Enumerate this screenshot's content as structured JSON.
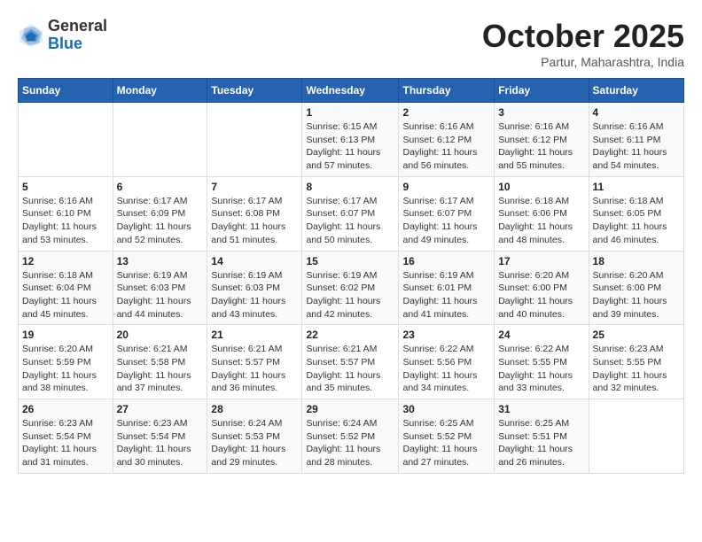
{
  "header": {
    "logo": {
      "general": "General",
      "blue": "Blue"
    },
    "title": "October 2025",
    "location": "Partur, Maharashtra, India"
  },
  "weekdays": [
    "Sunday",
    "Monday",
    "Tuesday",
    "Wednesday",
    "Thursday",
    "Friday",
    "Saturday"
  ],
  "weeks": [
    [
      {
        "day": "",
        "info": ""
      },
      {
        "day": "",
        "info": ""
      },
      {
        "day": "",
        "info": ""
      },
      {
        "day": "1",
        "info": "Sunrise: 6:15 AM\nSunset: 6:13 PM\nDaylight: 11 hours\nand 57 minutes."
      },
      {
        "day": "2",
        "info": "Sunrise: 6:16 AM\nSunset: 6:12 PM\nDaylight: 11 hours\nand 56 minutes."
      },
      {
        "day": "3",
        "info": "Sunrise: 6:16 AM\nSunset: 6:12 PM\nDaylight: 11 hours\nand 55 minutes."
      },
      {
        "day": "4",
        "info": "Sunrise: 6:16 AM\nSunset: 6:11 PM\nDaylight: 11 hours\nand 54 minutes."
      }
    ],
    [
      {
        "day": "5",
        "info": "Sunrise: 6:16 AM\nSunset: 6:10 PM\nDaylight: 11 hours\nand 53 minutes."
      },
      {
        "day": "6",
        "info": "Sunrise: 6:17 AM\nSunset: 6:09 PM\nDaylight: 11 hours\nand 52 minutes."
      },
      {
        "day": "7",
        "info": "Sunrise: 6:17 AM\nSunset: 6:08 PM\nDaylight: 11 hours\nand 51 minutes."
      },
      {
        "day": "8",
        "info": "Sunrise: 6:17 AM\nSunset: 6:07 PM\nDaylight: 11 hours\nand 50 minutes."
      },
      {
        "day": "9",
        "info": "Sunrise: 6:17 AM\nSunset: 6:07 PM\nDaylight: 11 hours\nand 49 minutes."
      },
      {
        "day": "10",
        "info": "Sunrise: 6:18 AM\nSunset: 6:06 PM\nDaylight: 11 hours\nand 48 minutes."
      },
      {
        "day": "11",
        "info": "Sunrise: 6:18 AM\nSunset: 6:05 PM\nDaylight: 11 hours\nand 46 minutes."
      }
    ],
    [
      {
        "day": "12",
        "info": "Sunrise: 6:18 AM\nSunset: 6:04 PM\nDaylight: 11 hours\nand 45 minutes."
      },
      {
        "day": "13",
        "info": "Sunrise: 6:19 AM\nSunset: 6:03 PM\nDaylight: 11 hours\nand 44 minutes."
      },
      {
        "day": "14",
        "info": "Sunrise: 6:19 AM\nSunset: 6:03 PM\nDaylight: 11 hours\nand 43 minutes."
      },
      {
        "day": "15",
        "info": "Sunrise: 6:19 AM\nSunset: 6:02 PM\nDaylight: 11 hours\nand 42 minutes."
      },
      {
        "day": "16",
        "info": "Sunrise: 6:19 AM\nSunset: 6:01 PM\nDaylight: 11 hours\nand 41 minutes."
      },
      {
        "day": "17",
        "info": "Sunrise: 6:20 AM\nSunset: 6:00 PM\nDaylight: 11 hours\nand 40 minutes."
      },
      {
        "day": "18",
        "info": "Sunrise: 6:20 AM\nSunset: 6:00 PM\nDaylight: 11 hours\nand 39 minutes."
      }
    ],
    [
      {
        "day": "19",
        "info": "Sunrise: 6:20 AM\nSunset: 5:59 PM\nDaylight: 11 hours\nand 38 minutes."
      },
      {
        "day": "20",
        "info": "Sunrise: 6:21 AM\nSunset: 5:58 PM\nDaylight: 11 hours\nand 37 minutes."
      },
      {
        "day": "21",
        "info": "Sunrise: 6:21 AM\nSunset: 5:57 PM\nDaylight: 11 hours\nand 36 minutes."
      },
      {
        "day": "22",
        "info": "Sunrise: 6:21 AM\nSunset: 5:57 PM\nDaylight: 11 hours\nand 35 minutes."
      },
      {
        "day": "23",
        "info": "Sunrise: 6:22 AM\nSunset: 5:56 PM\nDaylight: 11 hours\nand 34 minutes."
      },
      {
        "day": "24",
        "info": "Sunrise: 6:22 AM\nSunset: 5:55 PM\nDaylight: 11 hours\nand 33 minutes."
      },
      {
        "day": "25",
        "info": "Sunrise: 6:23 AM\nSunset: 5:55 PM\nDaylight: 11 hours\nand 32 minutes."
      }
    ],
    [
      {
        "day": "26",
        "info": "Sunrise: 6:23 AM\nSunset: 5:54 PM\nDaylight: 11 hours\nand 31 minutes."
      },
      {
        "day": "27",
        "info": "Sunrise: 6:23 AM\nSunset: 5:54 PM\nDaylight: 11 hours\nand 30 minutes."
      },
      {
        "day": "28",
        "info": "Sunrise: 6:24 AM\nSunset: 5:53 PM\nDaylight: 11 hours\nand 29 minutes."
      },
      {
        "day": "29",
        "info": "Sunrise: 6:24 AM\nSunset: 5:52 PM\nDaylight: 11 hours\nand 28 minutes."
      },
      {
        "day": "30",
        "info": "Sunrise: 6:25 AM\nSunset: 5:52 PM\nDaylight: 11 hours\nand 27 minutes."
      },
      {
        "day": "31",
        "info": "Sunrise: 6:25 AM\nSunset: 5:51 PM\nDaylight: 11 hours\nand 26 minutes."
      },
      {
        "day": "",
        "info": ""
      }
    ]
  ]
}
